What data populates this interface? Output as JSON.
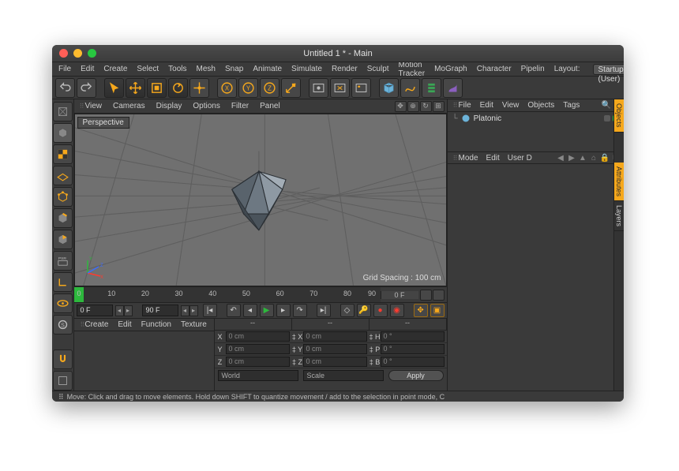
{
  "window": {
    "title": "Untitled 1 * - Main"
  },
  "menubar": {
    "items": [
      "File",
      "Edit",
      "Create",
      "Select",
      "Tools",
      "Mesh",
      "Snap",
      "Animate",
      "Simulate",
      "Render",
      "Sculpt",
      "Motion Tracker",
      "MoGraph",
      "Character",
      "Pipelin"
    ],
    "layout_label": "Layout:",
    "layout_value": "Startup (User)"
  },
  "viewport": {
    "menus": [
      "View",
      "Cameras",
      "Display",
      "Options",
      "Filter",
      "Panel"
    ],
    "label": "Perspective",
    "grid_spacing": "Grid Spacing : 100 cm",
    "axes": {
      "x": "X",
      "y": "Y",
      "z": "Z"
    }
  },
  "timeline": {
    "ticks": [
      "0",
      "10",
      "20",
      "30",
      "40",
      "50",
      "60",
      "70",
      "80",
      "90"
    ],
    "start_frame": "0 F",
    "end_frame": "90 F",
    "current_field": "0 F",
    "end_field": "90 F"
  },
  "material_panel": {
    "tabs": [
      "Create",
      "Edit",
      "Function",
      "Texture"
    ]
  },
  "coord_panel": {
    "headers": [
      "--",
      "--",
      "--"
    ],
    "rows": [
      {
        "axis": "X",
        "pos": "0 cm",
        "size_lbl": "X",
        "size": "0 cm",
        "rot_lbl": "H",
        "rot": "0 °"
      },
      {
        "axis": "Y",
        "pos": "0 cm",
        "size_lbl": "Y",
        "size": "0 cm",
        "rot_lbl": "P",
        "rot": "0 °"
      },
      {
        "axis": "Z",
        "pos": "0 cm",
        "size_lbl": "Z",
        "size": "0 cm",
        "rot_lbl": "B",
        "rot": "0 °"
      }
    ],
    "space": "World",
    "mode": "Scale",
    "apply": "Apply"
  },
  "object_manager": {
    "tabs": [
      "File",
      "Edit",
      "View",
      "Objects",
      "Tags"
    ],
    "object_name": "Platonic"
  },
  "attribute_manager": {
    "tabs": [
      "Mode",
      "Edit",
      "User D"
    ]
  },
  "side_tabs": [
    "Objects",
    "Attributes",
    "Layers"
  ],
  "statusbar": {
    "text": "Move: Click and drag to move elements. Hold down SHIFT to quantize movement / add to the selection in point mode, C"
  }
}
